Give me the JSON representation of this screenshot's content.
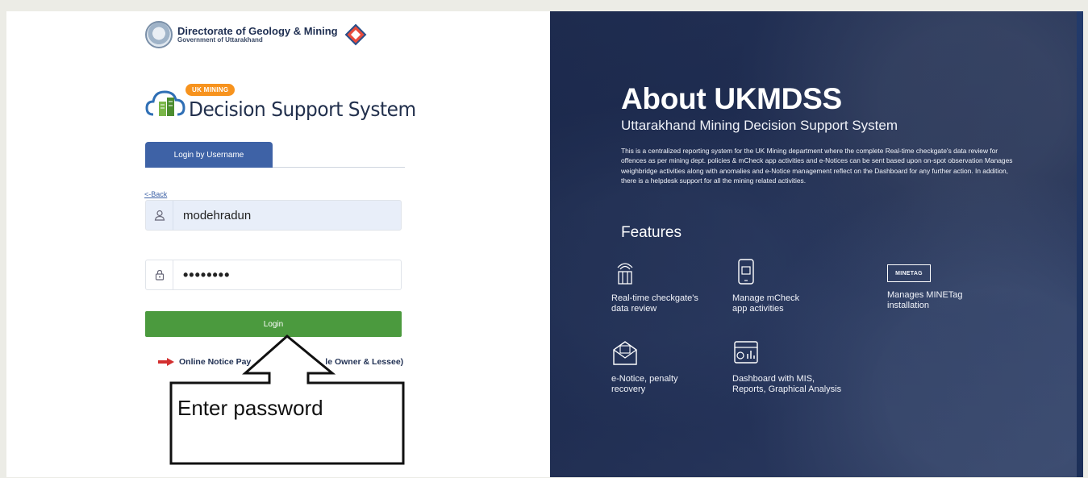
{
  "org": {
    "title": "Directorate of Geology & Mining",
    "subtitle": "Government of Uttarakhand"
  },
  "dss": {
    "badge": "UK MINING",
    "title": "Decision Support System"
  },
  "login": {
    "tab_label": "Login by Username",
    "back_label": "<-Back",
    "username_value": "modehradun",
    "password_value": "••••••••",
    "button_label": "Login",
    "notice_label": "Online Notice Pay",
    "notice_suffix": "le Owner & Lessee)"
  },
  "annotation": {
    "text": "Enter password"
  },
  "about": {
    "title": "About UKMDSS",
    "subtitle": "Uttarakhand Mining Decision Support System",
    "description": "This is a centralized reporting system for the UK Mining department where the complete Real-time checkgate's data review for offences as per mining dept. policies & mCheck app activities and e-Notices can be sent based upon on-spot observation Manages weighbridge activities along with anomalies and e-Notice management reflect on the Dashboard for any further action. In addition, there is a helpdesk support for all the mining related activities.",
    "features_title": "Features",
    "features": [
      {
        "icon": "checkgate-icon",
        "line1": "Real-time checkgate's",
        "line2": "data review"
      },
      {
        "icon": "mobile-app-icon",
        "line1": "Manage mCheck",
        "line2": "app activities"
      },
      {
        "icon": "minetag-icon",
        "tag": "MINETAG",
        "line1": "Manages MINETag",
        "line2": "installation"
      },
      {
        "icon": "envelope-notice-icon",
        "line1": "e-Notice, penalty",
        "line2": "recovery"
      },
      {
        "icon": "dashboard-icon",
        "line1": "Dashboard with MIS,",
        "line2": "Reports, Graphical Analysis"
      }
    ]
  },
  "colors": {
    "tab_blue": "#3e62a6",
    "login_green": "#4b9a3e",
    "badge_orange": "#f7931e",
    "panel_navy": "#2b3a61"
  }
}
